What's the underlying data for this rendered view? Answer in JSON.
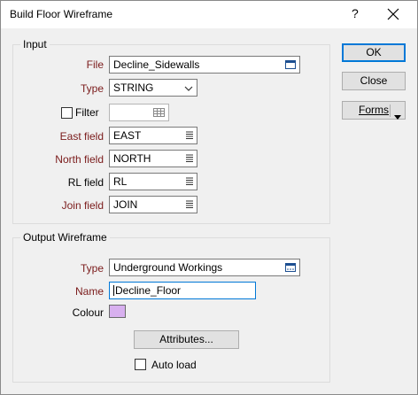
{
  "window": {
    "title": "Build Floor Wireframe",
    "help_label": "?"
  },
  "input_group": {
    "title": "Input",
    "file": {
      "label": "File",
      "value": "Decline_Sidewalls"
    },
    "type": {
      "label": "Type",
      "value": "STRING"
    },
    "filter": {
      "label": "Filter",
      "value": "",
      "checked": false
    },
    "east": {
      "label": "East field",
      "value": "EAST"
    },
    "north": {
      "label": "North field",
      "value": "NORTH"
    },
    "rl": {
      "label": "RL field",
      "value": "RL"
    },
    "join": {
      "label": "Join field",
      "value": "JOIN"
    }
  },
  "output_group": {
    "title": "Output Wireframe",
    "type": {
      "label": "Type",
      "value": "Underground Workings"
    },
    "name": {
      "label": "Name",
      "value": "Decline_Floor"
    },
    "colour": {
      "label": "Colour",
      "value": "#d8b0ef"
    },
    "attributes_button": "Attributes...",
    "auto_load": {
      "label": "Auto load",
      "checked": false
    }
  },
  "buttons": {
    "ok": "OK",
    "close": "Close",
    "forms": "Forms"
  },
  "colors": {
    "required_label": "#7a1a1a",
    "default_button_border": "#0078d7"
  }
}
